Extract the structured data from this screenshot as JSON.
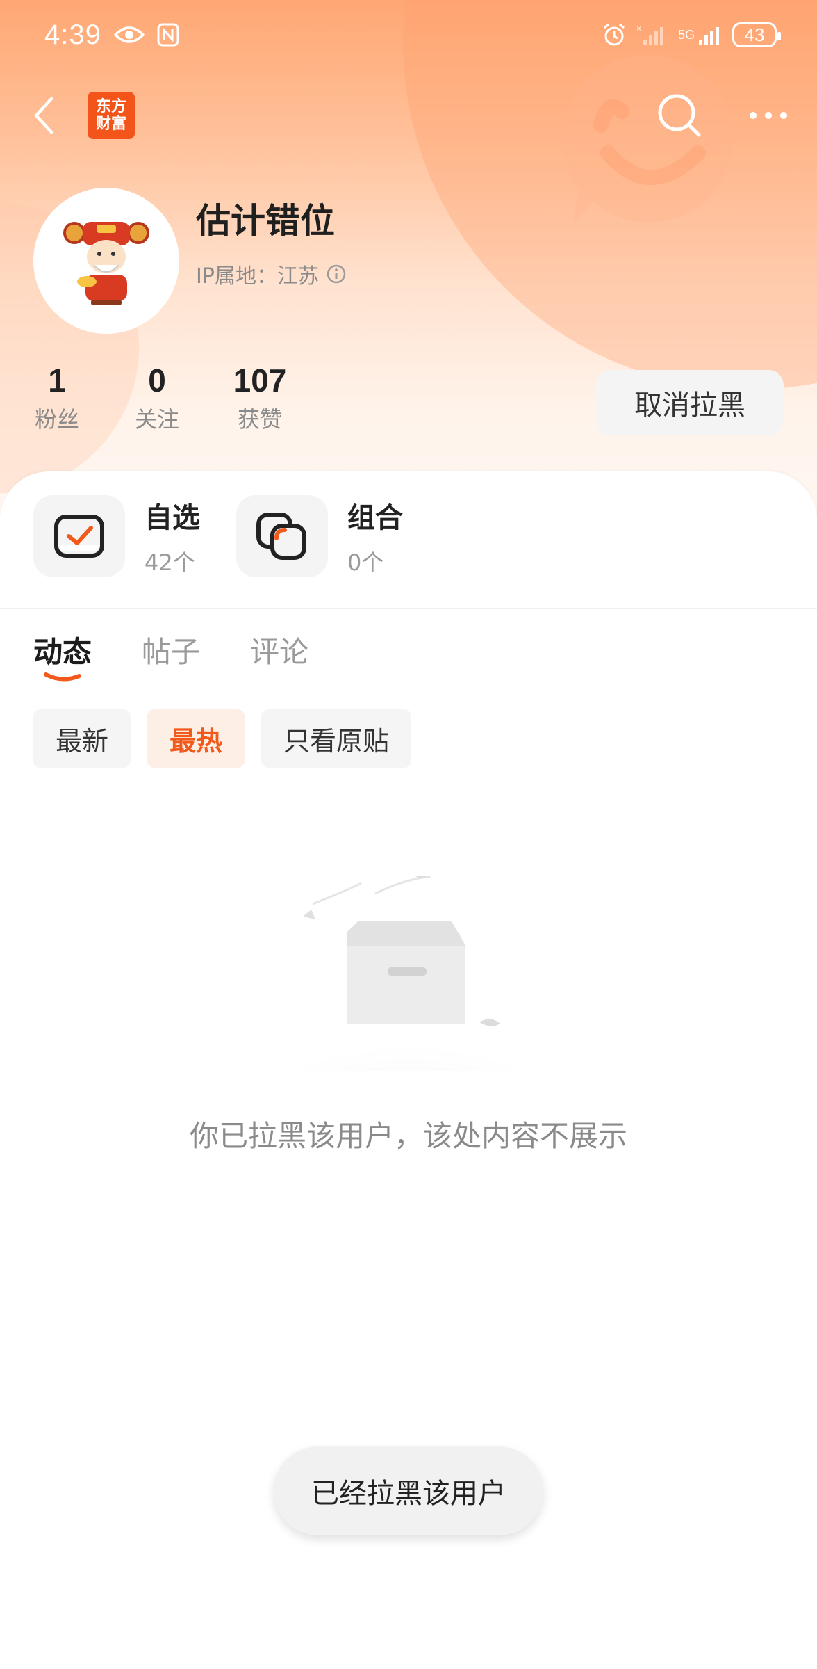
{
  "status_bar": {
    "time": "4:39",
    "network": "5G",
    "battery": "43"
  },
  "nav": {
    "app_logo_line1": "东方",
    "app_logo_line2": "财富"
  },
  "profile": {
    "username": "估计错位",
    "ip_location": "IP属地：江苏",
    "stats": [
      {
        "value": "1",
        "label": "粉丝"
      },
      {
        "value": "0",
        "label": "关注"
      },
      {
        "value": "107",
        "label": "获赞"
      }
    ],
    "unblock_label": "取消拉黑"
  },
  "portfolio": [
    {
      "title": "自选",
      "count": "42个"
    },
    {
      "title": "组合",
      "count": "0个"
    }
  ],
  "tabs": [
    {
      "label": "动态",
      "active": true
    },
    {
      "label": "帖子",
      "active": false
    },
    {
      "label": "评论",
      "active": false
    }
  ],
  "filters": [
    {
      "label": "最新",
      "active": false
    },
    {
      "label": "最热",
      "active": true
    },
    {
      "label": "只看原贴",
      "active": false
    }
  ],
  "empty_state": {
    "message": "你已拉黑该用户，该处内容不展示"
  },
  "toast": {
    "message": "已经拉黑该用户"
  },
  "colors": {
    "accent": "#f25a1c",
    "logo": "#f3541a",
    "header_gradient_top": "#ffa773"
  }
}
